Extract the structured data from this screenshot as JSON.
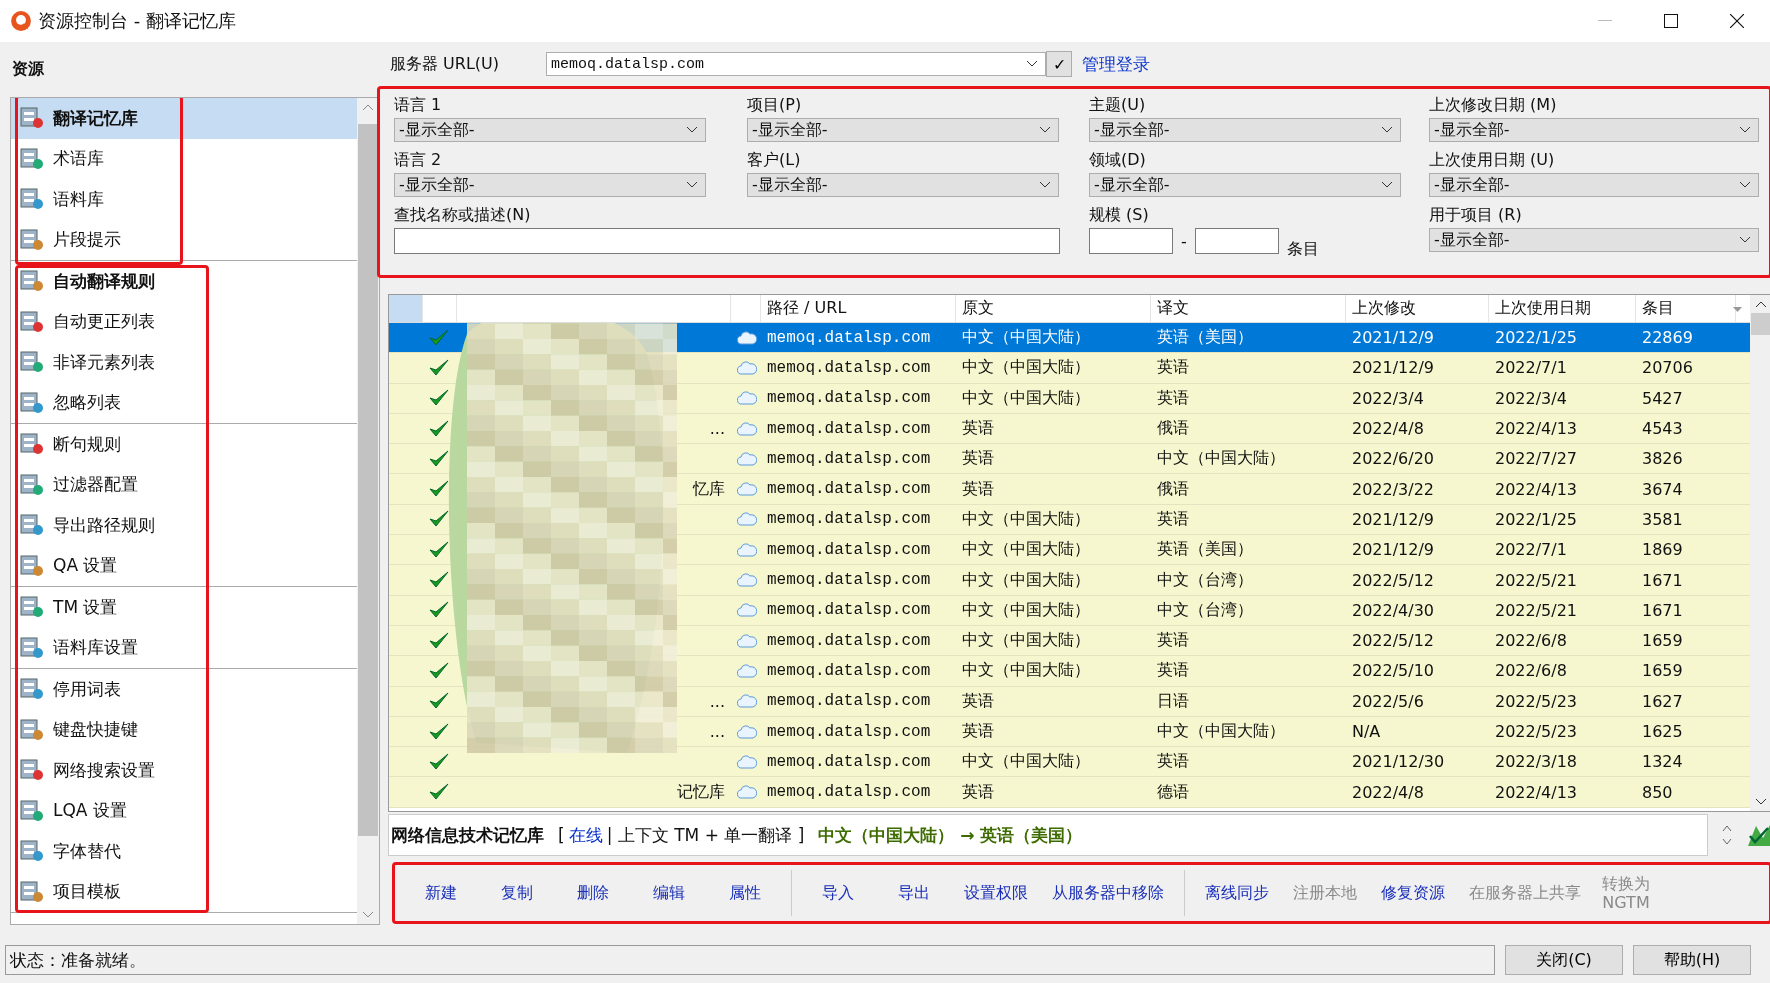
{
  "window": {
    "title": "资源控制台 - 翻译记忆库"
  },
  "sidebar": {
    "heading": "资源",
    "sections": [
      {
        "highlighted": true,
        "groups": [
          [
            {
              "label": "翻译记忆库",
              "selected": true,
              "bold": true
            },
            {
              "label": "术语库",
              "selected": false,
              "bold": false
            },
            {
              "label": "语料库",
              "selected": false,
              "bold": false
            },
            {
              "label": "片段提示",
              "selected": false,
              "bold": false
            }
          ]
        ]
      },
      {
        "highlighted": true,
        "groups": [
          [
            {
              "label": "自动翻译规则",
              "selected": false,
              "bold": true
            },
            {
              "label": "自动更正列表",
              "selected": false,
              "bold": false
            },
            {
              "label": "非译元素列表",
              "selected": false,
              "bold": false
            },
            {
              "label": "忽略列表",
              "selected": false,
              "bold": false
            }
          ],
          [
            {
              "label": "断句规则",
              "selected": false,
              "bold": false
            },
            {
              "label": "过滤器配置",
              "selected": false,
              "bold": false
            },
            {
              "label": "导出路径规则",
              "selected": false,
              "bold": false
            },
            {
              "label": "QA 设置",
              "selected": false,
              "bold": false
            }
          ],
          [
            {
              "label": "TM 设置",
              "selected": false,
              "bold": false
            },
            {
              "label": "语料库设置",
              "selected": false,
              "bold": false
            }
          ],
          [
            {
              "label": "停用词表",
              "selected": false,
              "bold": false
            },
            {
              "label": "键盘快捷键",
              "selected": false,
              "bold": false
            },
            {
              "label": "网络搜索设置",
              "selected": false,
              "bold": false
            },
            {
              "label": "LQA 设置",
              "selected": false,
              "bold": false
            },
            {
              "label": "字体替代",
              "selected": false,
              "bold": false
            },
            {
              "label": "项目模板",
              "selected": false,
              "bold": false
            }
          ]
        ]
      }
    ]
  },
  "server": {
    "label": "服务器 URL(U)",
    "value": "memoq.datalsp.com",
    "confirm": "✓",
    "link": "管理登录"
  },
  "filters": {
    "highlighted": true,
    "fields": [
      {
        "label": "语言 1",
        "value": "-显示全部-"
      },
      {
        "label": "项目(P)",
        "value": "-显示全部-"
      },
      {
        "label": "主题(U)",
        "value": "-显示全部-"
      },
      {
        "label": "上次修改日期 (M)",
        "value": "-显示全部-"
      },
      {
        "label": "语言 2",
        "value": "-显示全部-"
      },
      {
        "label": "客户(L)",
        "value": "-显示全部-"
      },
      {
        "label": "领域(D)",
        "value": "-显示全部-"
      },
      {
        "label": "上次使用日期 (U)",
        "value": "-显示全部-"
      }
    ],
    "search_label": "查找名称或描述(N)",
    "size_label": "规模 (S)",
    "size_dash": "-",
    "size_unit": "条目",
    "used_label": "用于项目 (R)",
    "used_value": "-显示全部-"
  },
  "table": {
    "columns": [
      "路径 / URL",
      "原文",
      "译文",
      "上次修改",
      "上次使用日期",
      "条目"
    ],
    "rows": [
      {
        "selected": true,
        "path": "memoq.datalsp.com",
        "source": "中文（中国大陆）",
        "target": "英语（美国）",
        "modified": "2021/12/9",
        "used": "2022/1/25",
        "entries": "22869"
      },
      {
        "selected": false,
        "path": "memoq.datalsp.com",
        "source": "中文（中国大陆）",
        "target": "英语",
        "modified": "2021/12/9",
        "used": "2022/7/1",
        "entries": "20706"
      },
      {
        "selected": false,
        "path": "memoq.datalsp.com",
        "source": "中文（中国大陆）",
        "target": "英语",
        "modified": "2022/3/4",
        "used": "2022/3/4",
        "entries": "5427"
      },
      {
        "selected": false,
        "name_fragment": "...",
        "path": "memoq.datalsp.com",
        "source": "英语",
        "target": "俄语",
        "modified": "2022/4/8",
        "used": "2022/4/13",
        "entries": "4543"
      },
      {
        "selected": false,
        "path": "memoq.datalsp.com",
        "source": "英语",
        "target": "中文（中国大陆）",
        "modified": "2022/6/20",
        "used": "2022/7/27",
        "entries": "3826"
      },
      {
        "selected": false,
        "name_fragment": "忆库",
        "path": "memoq.datalsp.com",
        "source": "英语",
        "target": "俄语",
        "modified": "2022/3/22",
        "used": "2022/4/13",
        "entries": "3674"
      },
      {
        "selected": false,
        "path": "memoq.datalsp.com",
        "source": "中文（中国大陆）",
        "target": "英语",
        "modified": "2021/12/9",
        "used": "2022/1/25",
        "entries": "3581"
      },
      {
        "selected": false,
        "path": "memoq.datalsp.com",
        "source": "中文（中国大陆）",
        "target": "英语（美国）",
        "modified": "2021/12/9",
        "used": "2022/7/1",
        "entries": "1869"
      },
      {
        "selected": false,
        "path": "memoq.datalsp.com",
        "source": "中文（中国大陆）",
        "target": "中文（台湾）",
        "modified": "2022/5/12",
        "used": "2022/5/21",
        "entries": "1671"
      },
      {
        "selected": false,
        "path": "memoq.datalsp.com",
        "source": "中文（中国大陆）",
        "target": "中文（台湾）",
        "modified": "2022/4/30",
        "used": "2022/5/21",
        "entries": "1671"
      },
      {
        "selected": false,
        "path": "memoq.datalsp.com",
        "source": "中文（中国大陆）",
        "target": "英语",
        "modified": "2022/5/12",
        "used": "2022/6/8",
        "entries": "1659"
      },
      {
        "selected": false,
        "path": "memoq.datalsp.com",
        "source": "中文（中国大陆）",
        "target": "英语",
        "modified": "2022/5/10",
        "used": "2022/6/8",
        "entries": "1659"
      },
      {
        "selected": false,
        "name_fragment": "...",
        "path": "memoq.datalsp.com",
        "source": "英语",
        "target": "日语",
        "modified": "2022/5/6",
        "used": "2022/5/23",
        "entries": "1627"
      },
      {
        "selected": false,
        "name_fragment": "...",
        "path": "memoq.datalsp.com",
        "source": "英语",
        "target": "中文（中国大陆）",
        "modified": "N/A",
        "used": "2022/5/23",
        "entries": "1625"
      },
      {
        "selected": false,
        "path": "memoq.datalsp.com",
        "source": "中文（中国大陆）",
        "target": "英语",
        "modified": "2021/12/30",
        "used": "2022/3/18",
        "entries": "1324"
      },
      {
        "selected": false,
        "name_fragment": "记忆库",
        "path": "memoq.datalsp.com",
        "source": "英语",
        "target": "德语",
        "modified": "2022/4/8",
        "used": "2022/4/13",
        "entries": "850"
      }
    ]
  },
  "info": {
    "name": "网络信息技术记忆库",
    "open": "[",
    "status": "在线",
    "detail": "| 上下文 TM + 单一翻译 ]",
    "languages": "中文（中国大陆） → 英语（美国）"
  },
  "actions": {
    "highlighted": true,
    "groups": [
      [
        {
          "label": "新建",
          "disabled": false
        },
        {
          "label": "复制",
          "disabled": false
        },
        {
          "label": "删除",
          "disabled": false
        },
        {
          "label": "编辑",
          "disabled": false
        },
        {
          "label": "属性",
          "disabled": false
        }
      ],
      [
        {
          "label": "导入",
          "disabled": false
        },
        {
          "label": "导出",
          "disabled": false
        },
        {
          "label": "设置权限",
          "disabled": false
        },
        {
          "label": "从服务器中移除",
          "disabled": false
        }
      ],
      [
        {
          "label": "离线同步",
          "disabled": false
        },
        {
          "label": "注册本地",
          "disabled": true
        },
        {
          "label": "修复资源",
          "disabled": false
        },
        {
          "label": "在服务器上共享",
          "disabled": true
        },
        {
          "label": "转换为 NGTM",
          "disabled": true
        }
      ]
    ]
  },
  "status_bar": {
    "text": "状态：准备就绪。",
    "buttons": [
      "关闭(C)",
      "帮助(H)"
    ]
  }
}
